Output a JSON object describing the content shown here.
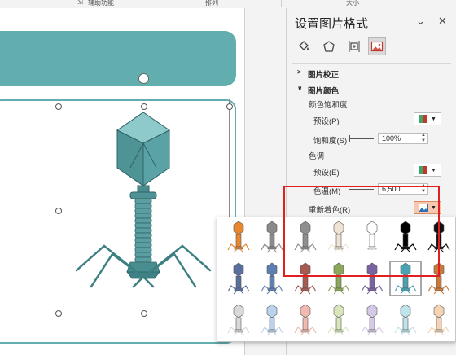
{
  "ribbon": {
    "accessibility": "辅助功能",
    "arrange": "排列",
    "size": "大小"
  },
  "pane": {
    "title": "设置图片格式",
    "tabs": [
      "fill-line-icon",
      "effects-icon",
      "size-properties-icon",
      "picture-icon"
    ],
    "corrections_header": "图片校正",
    "color_header": "图片颜色",
    "saturation_group": "颜色饱和度",
    "preset_label": "预设(P)",
    "saturation_label": "饱和度(S)",
    "saturation_value": "100%",
    "tone_group": "色调",
    "tone_preset_label": "预设(E)",
    "temperature_label": "色温(M)",
    "temperature_value": "6,500",
    "recolor_label": "重新着色(R)"
  },
  "colors": {
    "accent": "#62aeae",
    "highlight": "#e02020",
    "selected_recolor": "#f9c7b0"
  },
  "gallery": {
    "rows": [
      [
        "#e8872e",
        "#8a8a8a",
        "#8f8f8f",
        "#efe3d5",
        "#ffffff",
        "#000000",
        "#111111"
      ],
      [
        "#5a6f9e",
        "#5e7fb1",
        "#a55a52",
        "#8ca65a",
        "#7a63a1",
        "#4aa3b3",
        "#c97a3a"
      ],
      [
        "#d9d9d9",
        "#b9d3ee",
        "#f2b9b0",
        "#d7e7bb",
        "#d6c9e8",
        "#bde4ea",
        "#f6d3b3"
      ]
    ],
    "selected": "row2-col6"
  }
}
